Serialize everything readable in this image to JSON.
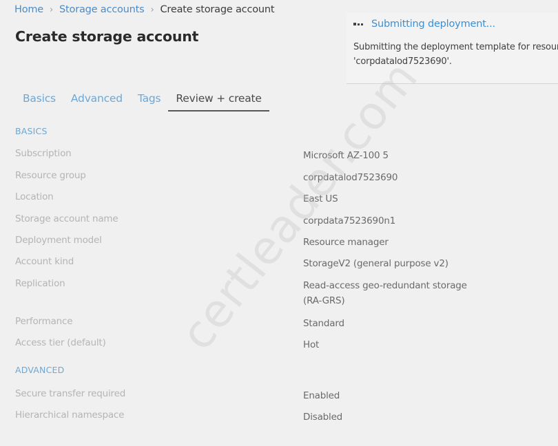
{
  "breadcrumb": {
    "items": [
      "Home",
      "Storage accounts"
    ],
    "current": "Create storage account",
    "separator": "›"
  },
  "page": {
    "title": "Create storage account"
  },
  "notification": {
    "icon": "in-progress-dots-icon",
    "title": "Submitting deployment...",
    "body_line1": "Submitting the deployment template for resource group",
    "body_line2": "'corpdatalod7523690'."
  },
  "tabs": [
    {
      "label": "Basics",
      "active": false
    },
    {
      "label": "Advanced",
      "active": false
    },
    {
      "label": "Tags",
      "active": false
    },
    {
      "label": "Review + create",
      "active": true
    }
  ],
  "sections": {
    "basics": {
      "heading": "BASICS",
      "rows": [
        {
          "label": "Subscription",
          "value": "Microsoft AZ-100 5"
        },
        {
          "label": "Resource group",
          "value": "corpdatalod7523690"
        },
        {
          "label": "Location",
          "value": "East US"
        },
        {
          "label": "Storage account name",
          "value": "corpdata7523690n1"
        },
        {
          "label": "Deployment model",
          "value": "Resource manager"
        },
        {
          "label": "Account kind",
          "value": "StorageV2 (general purpose v2)"
        },
        {
          "label": "Replication",
          "value": "Read-access geo-redundant storage",
          "value_line2": "(RA-GRS)"
        },
        {
          "label": "Performance",
          "value": "Standard"
        },
        {
          "label": "Access tier (default)",
          "value": "Hot"
        }
      ]
    },
    "advanced": {
      "heading": "ADVANCED",
      "rows": [
        {
          "label": "Secure transfer required",
          "value": "Enabled"
        },
        {
          "label": "Hierarchical namespace",
          "value": "Disabled"
        }
      ]
    }
  },
  "watermark": "certleader.com",
  "colors": {
    "accent": "#3d8fd1",
    "tab_inactive": "#6ea7d3",
    "background": "#f0f0f0"
  }
}
